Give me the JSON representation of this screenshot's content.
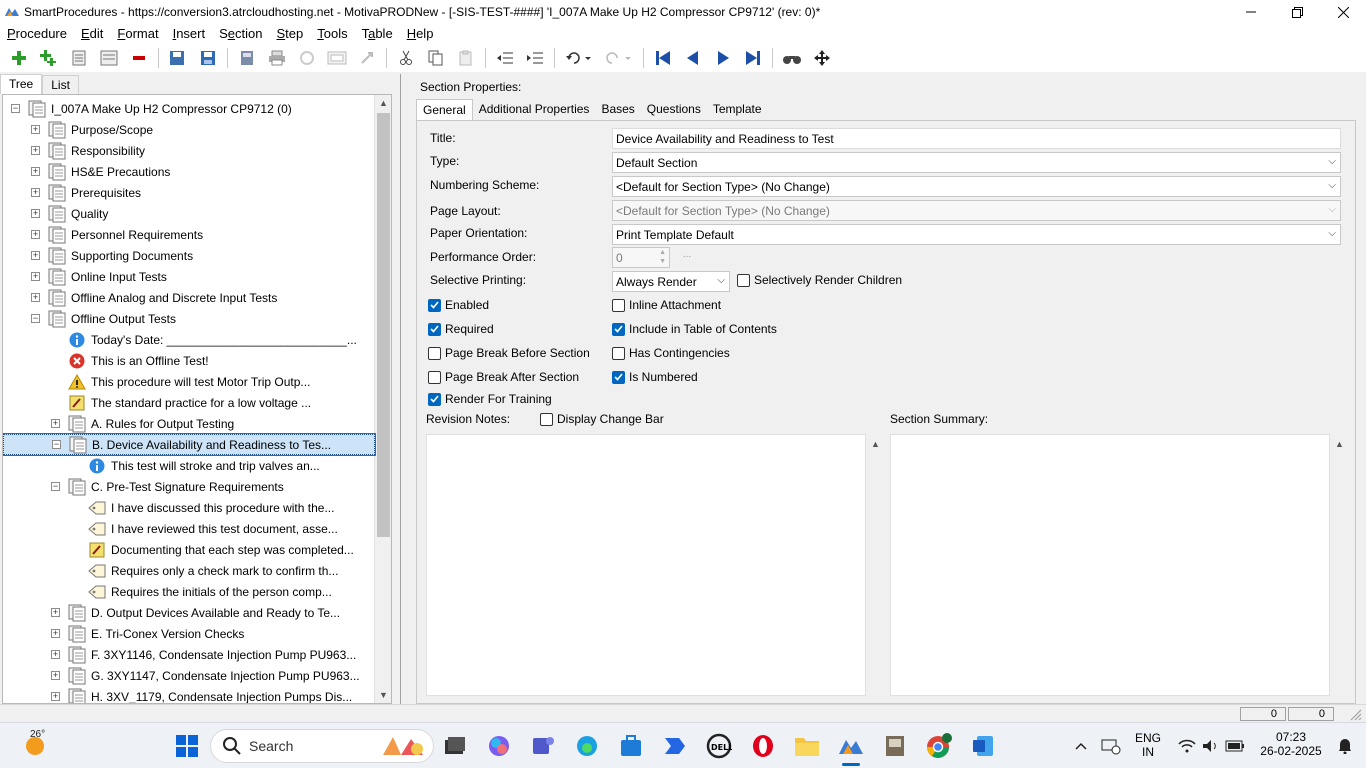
{
  "window": {
    "title": "SmartProcedures - https://conversion3.atrcloudhosting.net - MotivaPRODNew - [-SIS-TEST-####] 'I_007A Make Up H2 Compressor CP9712' (rev: 0)*"
  },
  "menu": [
    "Procedure",
    "Edit",
    "Format",
    "Insert",
    "Section",
    "Step",
    "Tools",
    "Table",
    "Help"
  ],
  "left_tabs": [
    "Tree",
    "List"
  ],
  "tree": [
    {
      "level": 0,
      "expander": "minus",
      "icon": "section",
      "label": "I_007A Make Up H2 Compressor CP9712 (0)"
    },
    {
      "level": 1,
      "expander": "plus",
      "icon": "section",
      "label": "Purpose/Scope"
    },
    {
      "level": 1,
      "expander": "plus",
      "icon": "section",
      "label": "Responsibility"
    },
    {
      "level": 1,
      "expander": "plus",
      "icon": "section",
      "label": "HS&E Precautions"
    },
    {
      "level": 1,
      "expander": "plus",
      "icon": "section",
      "label": "Prerequisites"
    },
    {
      "level": 1,
      "expander": "plus",
      "icon": "section",
      "label": "Quality"
    },
    {
      "level": 1,
      "expander": "plus",
      "icon": "section",
      "label": "Personnel Requirements"
    },
    {
      "level": 1,
      "expander": "plus",
      "icon": "section",
      "label": "Supporting Documents"
    },
    {
      "level": 1,
      "expander": "plus",
      "icon": "section",
      "label": "Online Input Tests"
    },
    {
      "level": 1,
      "expander": "plus",
      "icon": "section",
      "label": "Offline Analog and Discrete Input Tests"
    },
    {
      "level": 1,
      "expander": "minus",
      "icon": "section",
      "label": "Offline Output Tests"
    },
    {
      "level": 2,
      "expander": "",
      "icon": "info",
      "label": "Today's Date: ___________________________..."
    },
    {
      "level": 2,
      "expander": "",
      "icon": "error",
      "label": "This is an Offline Test!"
    },
    {
      "level": 2,
      "expander": "",
      "icon": "warning",
      "label": "This procedure will test Motor Trip Outp..."
    },
    {
      "level": 2,
      "expander": "",
      "icon": "note",
      "label": "The standard practice for a low voltage ..."
    },
    {
      "level": 2,
      "expander": "plus",
      "icon": "section",
      "label": "A. Rules for Output Testing"
    },
    {
      "level": 2,
      "expander": "minus",
      "icon": "section",
      "label": "B. Device Availability and Readiness to Tes...",
      "selected": true
    },
    {
      "level": 3,
      "expander": "",
      "icon": "info",
      "label": "This test will stroke and trip valves an..."
    },
    {
      "level": 2,
      "expander": "minus",
      "icon": "section",
      "label": "C. Pre-Test Signature Requirements"
    },
    {
      "level": 3,
      "expander": "",
      "icon": "step",
      "label": "I have discussed this procedure with the..."
    },
    {
      "level": 3,
      "expander": "",
      "icon": "step",
      "label": "I have reviewed this test document, asse..."
    },
    {
      "level": 3,
      "expander": "",
      "icon": "note",
      "label": "Documenting that each step was completed..."
    },
    {
      "level": 3,
      "expander": "",
      "icon": "step",
      "label": "Requires only a check mark to confirm th..."
    },
    {
      "level": 3,
      "expander": "",
      "icon": "step",
      "label": "Requires the initials of the person comp..."
    },
    {
      "level": 2,
      "expander": "plus",
      "icon": "section",
      "label": "D. Output Devices Available and Ready to Te..."
    },
    {
      "level": 2,
      "expander": "plus",
      "icon": "section",
      "label": "E. Tri-Conex Version Checks"
    },
    {
      "level": 2,
      "expander": "plus",
      "icon": "section",
      "label": "F. 3XY1146, Condensate Injection Pump PU963..."
    },
    {
      "level": 2,
      "expander": "plus",
      "icon": "section",
      "label": "G. 3XY1147, Condensate Injection Pump PU963..."
    },
    {
      "level": 2,
      "expander": "plus",
      "icon": "section",
      "label": "H. 3XV_1179, Condensate Injection Pumps Dis..."
    }
  ],
  "section_properties": {
    "heading": "Section Properties:",
    "tabs": [
      "General",
      "Additional Properties",
      "Bases",
      "Questions",
      "Template"
    ],
    "title_label": "Title:",
    "title_value": "Device Availability and Readiness to Test",
    "type_label": "Type:",
    "type_value": "Default Section",
    "numbering_label": "Numbering Scheme:",
    "numbering_value": "<Default for Section Type> (No Change)",
    "layout_label": "Page Layout:",
    "layout_value": "<Default for Section Type> (No Change)",
    "orientation_label": "Paper Orientation:",
    "orientation_value": "Print Template Default",
    "performance_label": "Performance Order:",
    "performance_value": "0",
    "performance_btn": "...",
    "selective_label": "Selective Printing:",
    "selective_value": "Always Render",
    "checkboxes": [
      {
        "label": "Selectively Render Children",
        "checked": false
      },
      {
        "label": "Enabled",
        "checked": true
      },
      {
        "label": "Inline Attachment",
        "checked": false
      },
      {
        "label": "Required",
        "checked": true
      },
      {
        "label": "Include in Table of Contents",
        "checked": true
      },
      {
        "label": "Page Break Before Section",
        "checked": false
      },
      {
        "label": "Has Contingencies",
        "checked": false
      },
      {
        "label": "Page Break After Section",
        "checked": false
      },
      {
        "label": "Is Numbered",
        "checked": true
      },
      {
        "label": "Render For Training",
        "checked": true
      },
      {
        "label": "Display Change Bar",
        "checked": false
      }
    ],
    "revision_notes_label": "Revision Notes:",
    "section_summary_label": "Section Summary:"
  },
  "status": {
    "cell1": "0",
    "cell2": "0"
  },
  "taskbar": {
    "weather": "26°",
    "search_placeholder": "Search",
    "lang_top": "ENG",
    "lang_bottom": "IN",
    "time": "07:23",
    "date": "26-02-2025"
  },
  "colors": {
    "accent": "#0067c0",
    "selection": "#cde3f7"
  }
}
